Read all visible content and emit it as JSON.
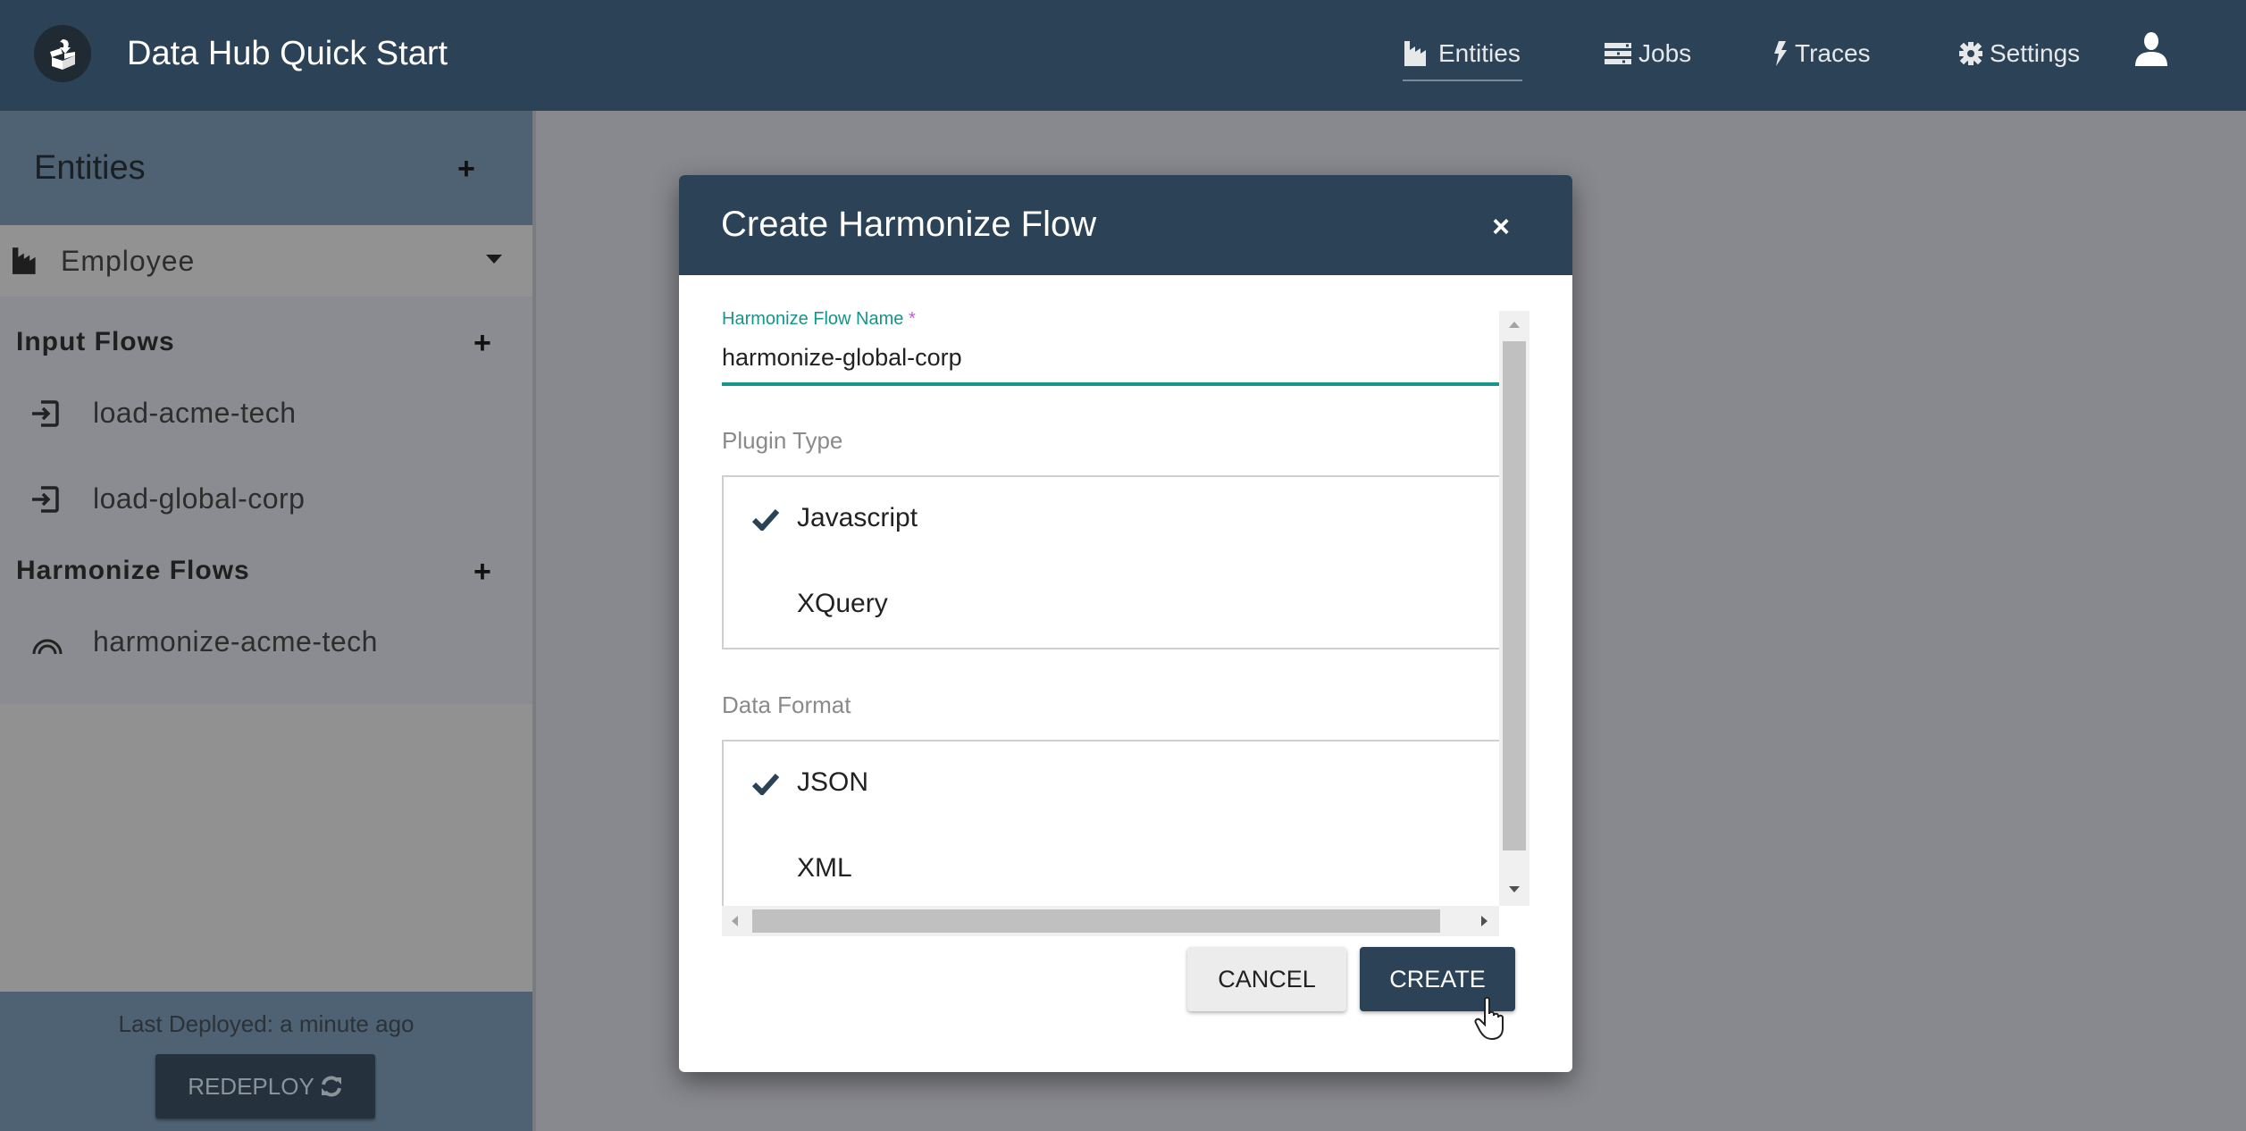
{
  "header": {
    "app_title": "Data Hub Quick Start",
    "logo_icon": "box-download-icon",
    "nav": [
      {
        "label": "Entities",
        "icon": "factory-icon",
        "active": true
      },
      {
        "label": "Jobs",
        "icon": "tasks-icon",
        "active": false
      },
      {
        "label": "Traces",
        "icon": "bolt-icon",
        "active": false
      },
      {
        "label": "Settings",
        "icon": "gear-icon",
        "active": false
      }
    ],
    "user_icon": "user-icon"
  },
  "sidebar": {
    "entities_title": "Entities",
    "add_symbol": "+",
    "entity": {
      "label": "Employee",
      "icon": "factory-icon",
      "expand_icon": "caret-down-icon"
    },
    "input_flows": {
      "title": "Input Flows",
      "items": [
        {
          "label": "load-acme-tech",
          "icon": "sign-in-icon"
        },
        {
          "label": "load-global-corp",
          "icon": "sign-in-icon"
        }
      ]
    },
    "harmonize_flows": {
      "title": "Harmonize Flows",
      "items": [
        {
          "label": "harmonize-acme-tech",
          "icon": "rainbow-icon"
        }
      ]
    },
    "footer": {
      "last_deployed": "Last Deployed: a minute ago",
      "redeploy_label": "REDEPLOY",
      "redeploy_icon": "refresh-icon"
    }
  },
  "dialog": {
    "title": "Create Harmonize Flow",
    "close_symbol": "×",
    "name_field": {
      "label": "Harmonize Flow Name",
      "required_marker": "*",
      "value": "harmonize-global-corp"
    },
    "plugin_type": {
      "label": "Plugin Type",
      "options": [
        {
          "label": "Javascript",
          "selected": true
        },
        {
          "label": "XQuery",
          "selected": false
        }
      ]
    },
    "data_format": {
      "label": "Data Format",
      "options": [
        {
          "label": "JSON",
          "selected": true
        },
        {
          "label": "XML",
          "selected": false
        }
      ]
    },
    "cancel_label": "CANCEL",
    "create_label": "CREATE"
  },
  "colors": {
    "header_bg": "#2c4257",
    "accent_teal": "#14968a",
    "required_marker": "#c05bd3",
    "overlay_bg": "#88898e"
  }
}
